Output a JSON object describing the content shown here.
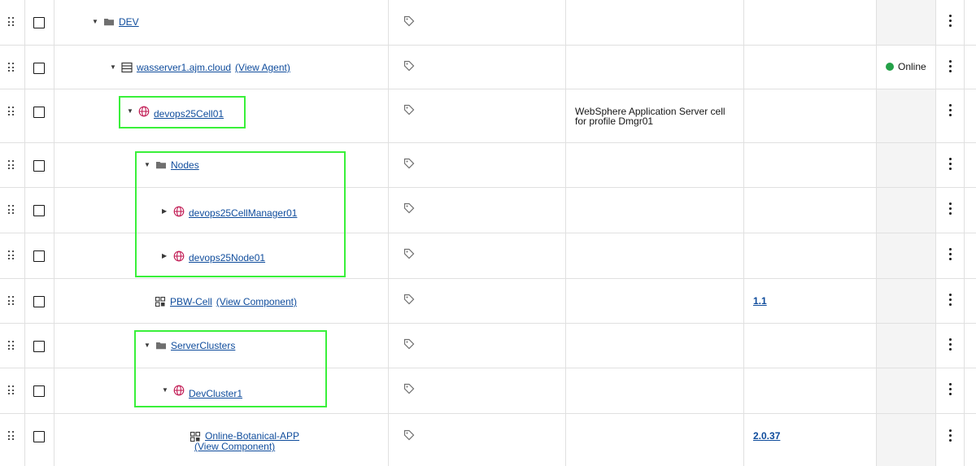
{
  "rows": [
    {
      "name": "DEV",
      "icon": "folder-icon",
      "caret": "▼"
    },
    {
      "name": "wasserver1.ajm.cloud",
      "icon": "server-icon",
      "caret": "▼",
      "sub_link": "(View Agent)",
      "status": "Online"
    },
    {
      "name": "devops25Cell01",
      "icon": "globe-icon",
      "caret": "▼",
      "description_line1": "WebSphere Application Server cell",
      "description_line2": "for profile Dmgr01"
    },
    {
      "name": "Nodes",
      "icon": "folder-icon",
      "caret": "▼"
    },
    {
      "name": "devops25CellManager01",
      "icon": "globe-icon",
      "caret": "▶"
    },
    {
      "name": "devops25Node01",
      "icon": "globe-icon",
      "caret": "▶"
    },
    {
      "name": "PBW-Cell",
      "icon": "component-icon",
      "sub_link": "(View Component)",
      "version": "1.1"
    },
    {
      "name": "ServerClusters",
      "icon": "folder-icon",
      "caret": "▼"
    },
    {
      "name": "DevCluster1",
      "icon": "globe-icon",
      "caret": "▼"
    },
    {
      "name": "Online-Botanical-APP",
      "icon": "component-icon",
      "sub_link": "(View Component)",
      "version": "2.0.37"
    }
  ],
  "colors": {
    "status_online": "#24a148",
    "highlight": "#39f03a",
    "globe_icon": "#c21e56",
    "link": "#0f4c9c"
  }
}
